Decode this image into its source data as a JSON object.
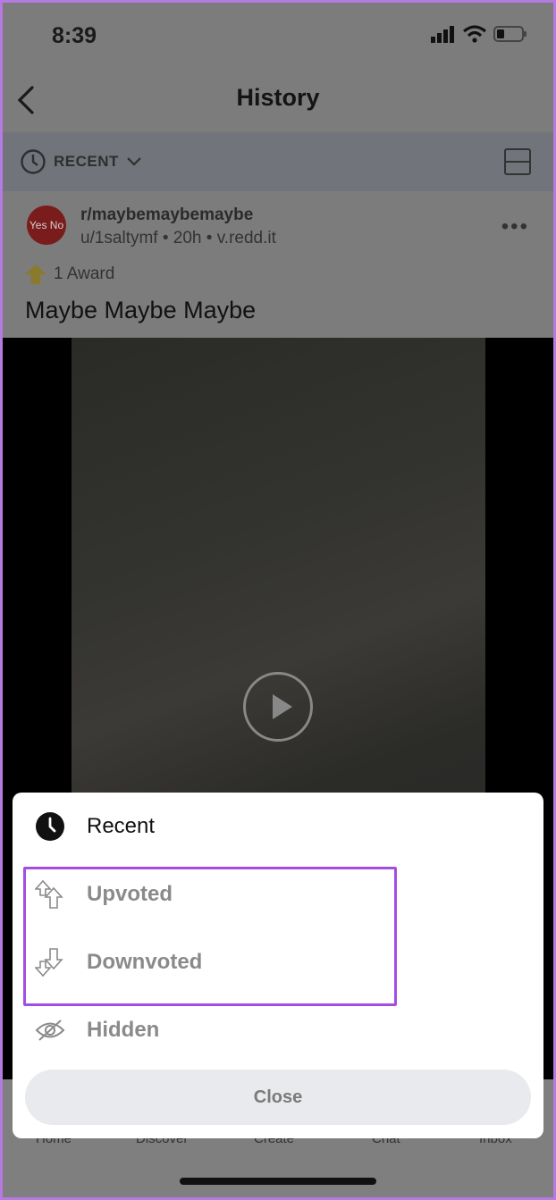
{
  "status": {
    "time": "8:39"
  },
  "header": {
    "title": "History"
  },
  "filter": {
    "label": "RECENT"
  },
  "post": {
    "subreddit": "r/maybemaybemaybe",
    "meta": "u/1saltymf • 20h • v.redd.it",
    "award": "1 Award",
    "title": "Maybe Maybe Maybe",
    "avatar_text": "Yes No"
  },
  "tabs": [
    "Home",
    "Discover",
    "Create",
    "Chat",
    "Inbox"
  ],
  "sheet": {
    "options": [
      {
        "label": "Recent",
        "icon": "clock-icon"
      },
      {
        "label": "Upvoted",
        "icon": "upvote-icon"
      },
      {
        "label": "Downvoted",
        "icon": "downvote-icon"
      },
      {
        "label": "Hidden",
        "icon": "eye-slash-icon"
      }
    ],
    "close_label": "Close"
  },
  "colors": {
    "highlight": "#a24de4",
    "frame": "#b57be0"
  }
}
